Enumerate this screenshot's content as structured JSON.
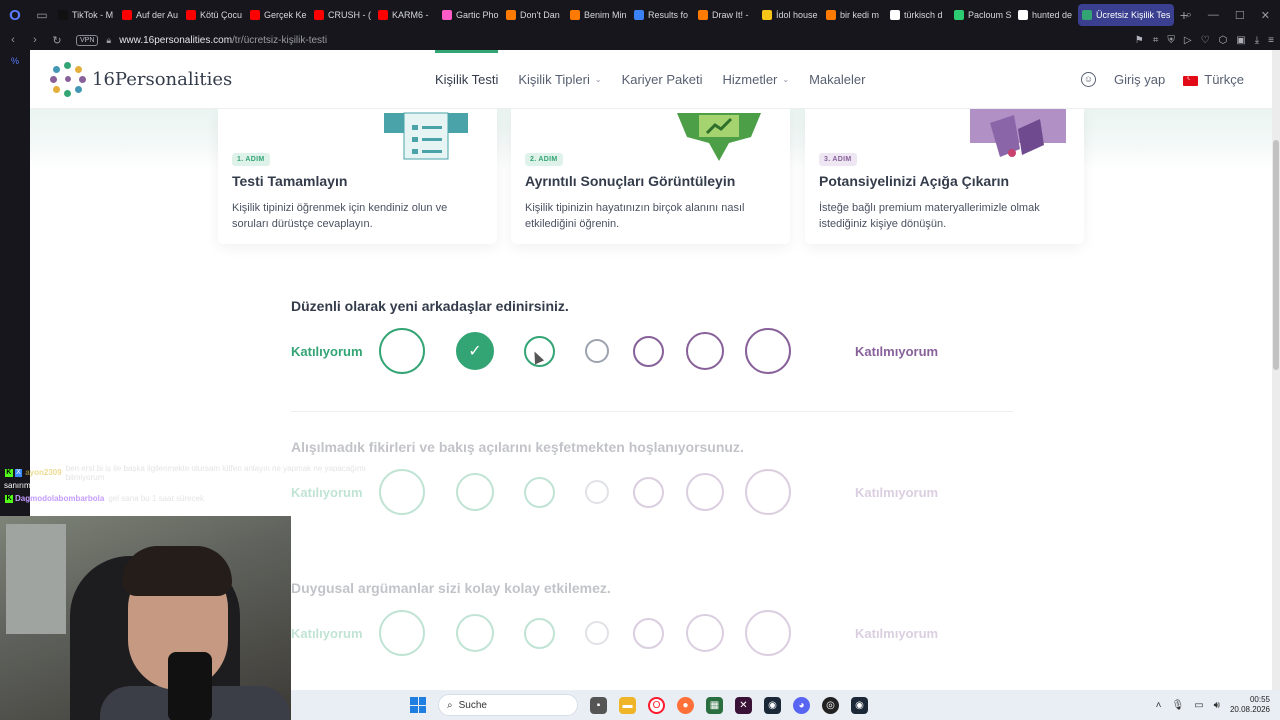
{
  "browser": {
    "tabs": [
      {
        "label": "TikTok - M",
        "color": "#111111"
      },
      {
        "label": "Auf der Au",
        "color": "#ff0000"
      },
      {
        "label": "Kötü Çocu",
        "color": "#ff0000"
      },
      {
        "label": "Gerçek Ke",
        "color": "#ff0000"
      },
      {
        "label": "CRUSH - (",
        "color": "#ff0000"
      },
      {
        "label": "KARM6 - ",
        "color": "#ff0000"
      },
      {
        "label": "Gartic Pho",
        "color": "#ff5cc8"
      },
      {
        "label": "Don't Dan",
        "color": "#ff7a00"
      },
      {
        "label": "Benim Min",
        "color": "#ff7a00"
      },
      {
        "label": "Results fo",
        "color": "#3b82f6"
      },
      {
        "label": "Draw It! -",
        "color": "#ff7a00"
      },
      {
        "label": "İdol house",
        "color": "#f5c518"
      },
      {
        "label": "bir kedi m",
        "color": "#ff7a00"
      },
      {
        "label": "türkisch d",
        "color": "#ffffff"
      },
      {
        "label": "Pacloum S",
        "color": "#2ecc71"
      },
      {
        "label": "hunted de",
        "color": "#ffffff"
      },
      {
        "label": "Ücretsiz Kişilik Tes",
        "color": "#33a474"
      }
    ],
    "vpn_label": "VPN",
    "url_host": "www.16personalities.com",
    "url_path": "/tr/ücretsiz-kişilik-testi",
    "zoom_indicator": "%"
  },
  "header": {
    "brand": "16Personalities",
    "nav": [
      {
        "label": "Kişilik Testi",
        "active": true,
        "dropdown": false
      },
      {
        "label": "Kişilik Tipleri",
        "active": false,
        "dropdown": true
      },
      {
        "label": "Kariyer Paketi",
        "active": false,
        "dropdown": false
      },
      {
        "label": "Hizmetler",
        "active": false,
        "dropdown": true
      },
      {
        "label": "Makaleler",
        "active": false,
        "dropdown": false
      }
    ],
    "login": "Giriş yap",
    "language": "Türkçe"
  },
  "steps": [
    {
      "badge": "1. ADIM",
      "title": "Testi Tamamlayın",
      "desc": "Kişilik tipinizi öğrenmek için kendiniz olun ve soruları dürüstçe cevaplayın.",
      "color": "#33a474",
      "badge_bg": "#dff2ea"
    },
    {
      "badge": "2. ADIM",
      "title": "Ayrıntılı Sonuçları Görüntüleyin",
      "desc": "Kişilik tipinizin hayatınızın birçok alanını nasıl etkilediğini öğrenin.",
      "color": "#33a474",
      "badge_bg": "#dff2ea"
    },
    {
      "badge": "3. ADIM",
      "title": "Potansiyelinizi Açığa Çıkarın",
      "desc": "İsteğe bağlı premium materyallerimizle olmak istediğiniz kişiye dönüşün.",
      "color": "#88619a",
      "badge_bg": "#efe6f3"
    }
  ],
  "questions": [
    {
      "text": "Düzenli olarak yeni arkadaşlar edinirsiniz.",
      "agree": "Katılıyorum",
      "disagree": "Katılmıyorum",
      "selected": 1,
      "faded": false
    },
    {
      "text": "Alışılmadık fikirleri ve bakış açılarını keşfetmekten hoşlanıyorsunuz.",
      "agree": "Katılıyorum",
      "disagree": "Katılmıyorum",
      "selected": null,
      "faded": true
    },
    {
      "text": "Duygusal argümanlar sizi kolay kolay etkilemez.",
      "agree": "Katılıyorum",
      "disagree": "Katılmıyorum",
      "selected": null,
      "faded": true
    }
  ],
  "chat": [
    {
      "user": "ayon2309",
      "msg": "ben erst bi iş ile başka ilgilenmekte olursam lütfen anlayın ne yapmak ne yapacağımı bilmiyorum"
    },
    {
      "user": "",
      "msg": "sanırım"
    },
    {
      "user": "Dagmodolabombarbola",
      "msg": "gel sana bu 1 saat sürecek"
    }
  ],
  "taskbar": {
    "search_placeholder": "Suche",
    "time": "00:55",
    "date": "20.08.2026"
  },
  "colors": {
    "agree": "#33a474",
    "disagree": "#88619a",
    "neutral": "#9ca3af"
  }
}
